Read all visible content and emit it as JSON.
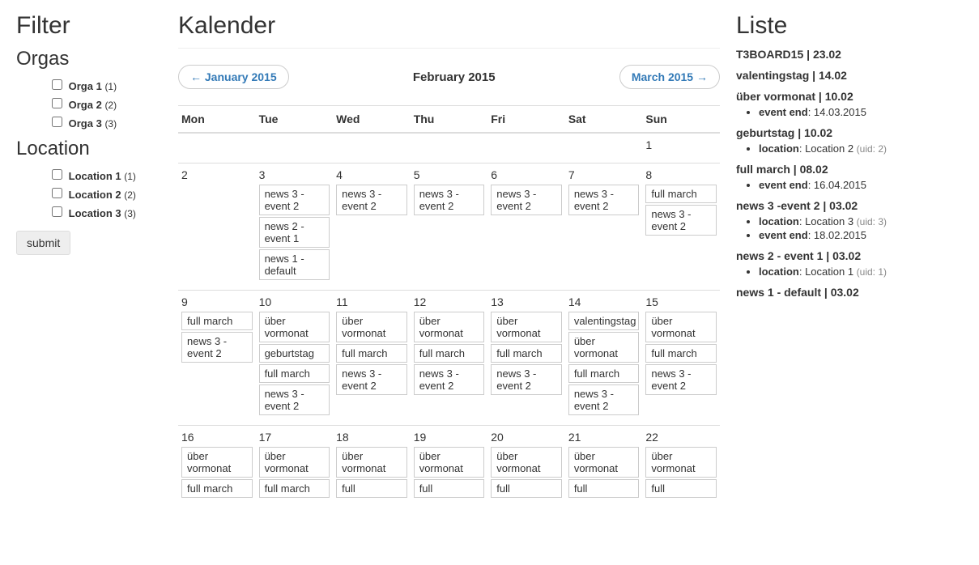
{
  "filter": {
    "title": "Filter",
    "orgas_title": "Orgas",
    "location_title": "Location",
    "submit_label": "submit",
    "orgas": [
      {
        "label": "Orga 1",
        "count": "(1)"
      },
      {
        "label": "Orga 2",
        "count": "(2)"
      },
      {
        "label": "Orga 3",
        "count": "(3)"
      }
    ],
    "locations": [
      {
        "label": "Location 1",
        "count": "(1)"
      },
      {
        "label": "Location 2",
        "count": "(2)"
      },
      {
        "label": "Location 3",
        "count": "(3)"
      }
    ]
  },
  "calendar": {
    "title": "Kalender",
    "prev_label": "← January 2015",
    "month_label": "February 2015",
    "next_label": "March 2015 →",
    "weekdays": [
      "Mon",
      "Tue",
      "Wed",
      "Thu",
      "Fri",
      "Sat",
      "Sun"
    ],
    "weeks": [
      [
        {
          "day": "",
          "events": []
        },
        {
          "day": "",
          "events": []
        },
        {
          "day": "",
          "events": []
        },
        {
          "day": "",
          "events": []
        },
        {
          "day": "",
          "events": []
        },
        {
          "day": "",
          "events": []
        },
        {
          "day": "1",
          "events": []
        }
      ],
      [
        {
          "day": "2",
          "events": []
        },
        {
          "day": "3",
          "events": [
            "news 3 - event 2",
            "news 2 - event 1",
            "news 1 - default"
          ]
        },
        {
          "day": "4",
          "events": [
            "news 3 - event 2"
          ]
        },
        {
          "day": "5",
          "events": [
            "news 3 - event 2"
          ]
        },
        {
          "day": "6",
          "events": [
            "news 3 - event 2"
          ]
        },
        {
          "day": "7",
          "events": [
            "news 3 - event 2"
          ]
        },
        {
          "day": "8",
          "events": [
            "full march",
            "news 3 - event 2"
          ]
        }
      ],
      [
        {
          "day": "9",
          "events": [
            "full march",
            "news 3 - event 2"
          ]
        },
        {
          "day": "10",
          "events": [
            "über vormonat",
            "geburtstag",
            "full march",
            "news 3 - event 2"
          ]
        },
        {
          "day": "11",
          "events": [
            "über vormonat",
            "full march",
            "news 3 - event 2"
          ]
        },
        {
          "day": "12",
          "events": [
            "über vormonat",
            "full march",
            "news 3 - event 2"
          ]
        },
        {
          "day": "13",
          "events": [
            "über vormonat",
            "full march",
            "news 3 - event 2"
          ]
        },
        {
          "day": "14",
          "events": [
            "valentingstag",
            "über vormonat",
            "full march",
            "news 3 - event 2"
          ]
        },
        {
          "day": "15",
          "events": [
            "über vormonat",
            "full march",
            "news 3 - event 2"
          ]
        }
      ],
      [
        {
          "day": "16",
          "events": [
            "über vormonat",
            "full march"
          ]
        },
        {
          "day": "17",
          "events": [
            "über vormonat",
            "full march"
          ]
        },
        {
          "day": "18",
          "events": [
            "über vormonat",
            "full"
          ]
        },
        {
          "day": "19",
          "events": [
            "über vormonat",
            "full"
          ]
        },
        {
          "day": "20",
          "events": [
            "über vormonat",
            "full"
          ]
        },
        {
          "day": "21",
          "events": [
            "über vormonat",
            "full"
          ]
        },
        {
          "day": "22",
          "events": [
            "über vormonat",
            "full"
          ]
        }
      ]
    ]
  },
  "list": {
    "title": "Liste",
    "items": [
      {
        "title": "T3BOARD15 | 23.02",
        "details": []
      },
      {
        "title": "valentingstag | 14.02",
        "details": []
      },
      {
        "title": "über vormonat | 10.02",
        "details": [
          {
            "label": "event end",
            "value": ": 14.03.2015"
          }
        ]
      },
      {
        "title": "geburtstag | 10.02",
        "details": [
          {
            "label": "location",
            "value": ": Location 2 ",
            "muted": "(uid: 2)"
          }
        ]
      },
      {
        "title": "full march | 08.02",
        "details": [
          {
            "label": "event end",
            "value": ": 16.04.2015"
          }
        ]
      },
      {
        "title": "news 3 -event 2 | 03.02",
        "details": [
          {
            "label": "location",
            "value": ": Location 3 ",
            "muted": "(uid: 3)"
          },
          {
            "label": "event end",
            "value": ": 18.02.2015"
          }
        ]
      },
      {
        "title": "news 2 - event 1 | 03.02",
        "details": [
          {
            "label": "location",
            "value": ": Location 1 ",
            "muted": "(uid: 1)"
          }
        ]
      },
      {
        "title": "news 1 - default | 03.02",
        "details": []
      }
    ]
  }
}
